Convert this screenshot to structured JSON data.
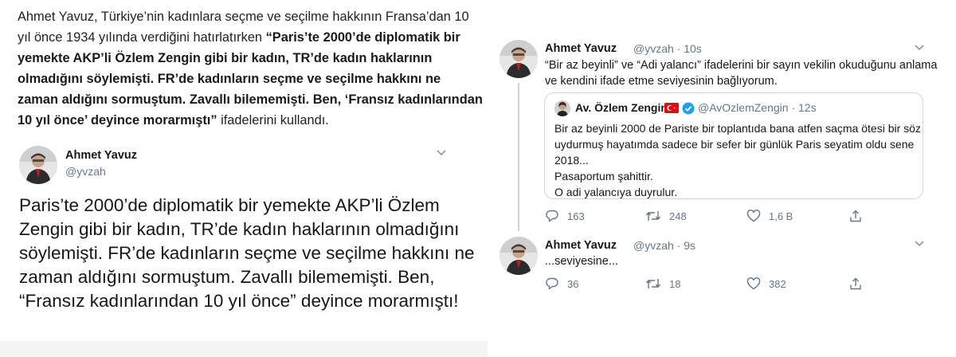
{
  "article": {
    "intro": "Ahmet Yavuz, Türkiye’nin kadınlara seçme ve seçilme hakkının Fransa’dan 10 yıl önce 1934 yılında verdiğini hatırlatırken ",
    "quote": "“Paris’te 2000’de diplomatik bir yemekte AKP’li Özlem Zengin gibi bir kadın, TR’de kadın haklarının olmadığını söylemişti. FR’de kadınların seçme ve seçilme hakkını ne zaman aldığını sormuştum. Zavallı bilememişti. Ben, ‘Fransız kadınlarından 10 yıl önce’ deyince morarmıştı”",
    "outro": " ifadelerini kullandı."
  },
  "left_tweet": {
    "name": "Ahmet Yavuz",
    "handle": "@yvzah",
    "text": "Paris’te 2000’de diplomatik bir yemekte AKP’li Özlem Zengin gibi bir kadın, TR’de kadın haklarının olmadığını söylemişti. FR’de kadınların seçme ve seçilme hakkını ne zaman aldığını sormuştum. Zavallı bilememişti. Ben, “Fransız kadınlarından 10 yıl önce” deyince morarmıştı!"
  },
  "tweet1": {
    "name": "Ahmet Yavuz",
    "meta": "@yvzah · 10s",
    "text": "“Bir az beyinli” ve “Adi yalancı” ifadelerini bir sayın vekilin okuduğunu anlama ve kendini ifade etme seviyesinin bağlıyorum.",
    "quoted": {
      "name": "Av. Özlem Zengin",
      "meta": "@AvOzlemZengin · 12s",
      "lines": [
        "Bir az beyinli 2000 de Pariste bir toplantıda bana atfen saçma ötesi bir söz",
        "uydurmuş hayatımda sadece bir sefer bir günlük Paris seyatim oldu sene",
        "2018...",
        "Pasaportum şahittir.",
        "O adi yalancıya duyrulur."
      ]
    },
    "actions": {
      "reply": "163",
      "retweet": "248",
      "like": "1,6 B"
    }
  },
  "tweet2": {
    "name": "Ahmet Yavuz",
    "meta": "@yvzah · 9s",
    "text": "...seviyesine...",
    "actions": {
      "reply": "36",
      "retweet": "18",
      "like": "382"
    }
  },
  "icons": {
    "reply": "reply-icon",
    "retweet": "retweet-icon",
    "like": "heart-icon",
    "share": "share-icon",
    "more": "chevron-down-icon",
    "verified": "verified-badge-icon",
    "flag": "turkey-flag-icon"
  },
  "colors": {
    "text": "#14171a",
    "muted": "#657786",
    "border": "#ccd6dd",
    "verified": "#1da1f2",
    "flag": "#e30a17"
  }
}
